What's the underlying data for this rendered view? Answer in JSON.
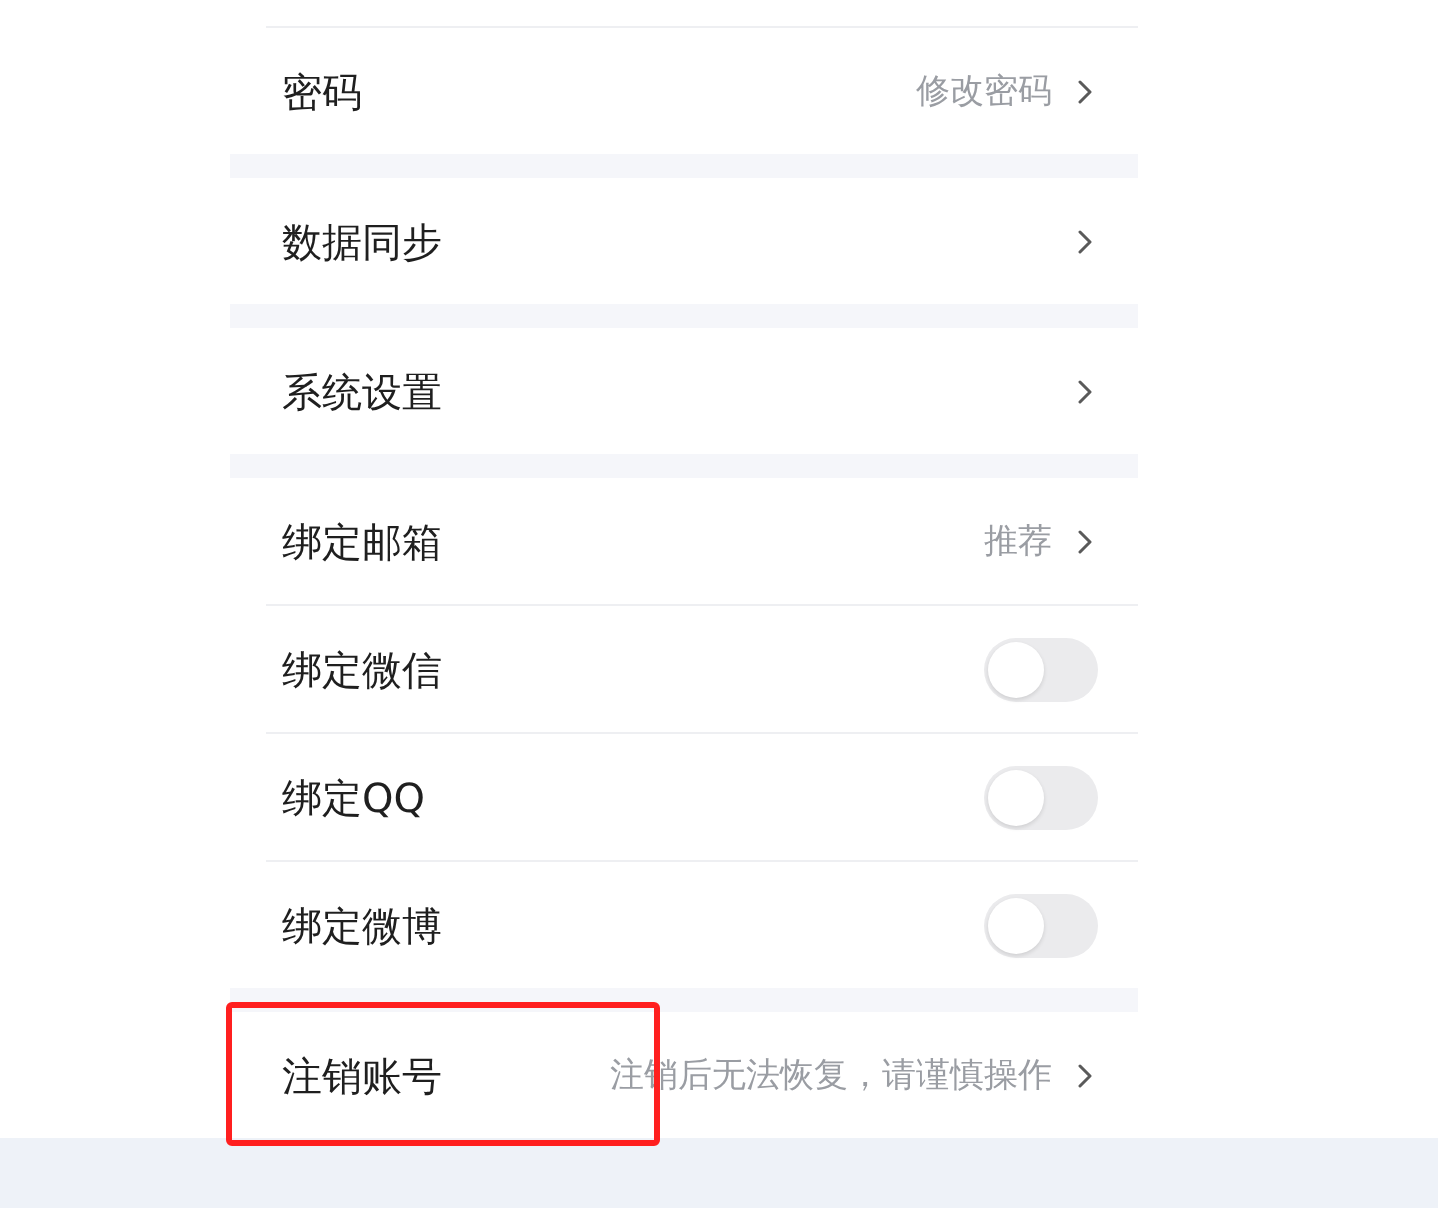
{
  "groups": [
    {
      "items": [
        {
          "kind": "link",
          "label": "密码",
          "hint": "修改密码",
          "highlighted": false
        }
      ]
    },
    {
      "items": [
        {
          "kind": "link",
          "label": "数据同步",
          "highlighted": false
        }
      ]
    },
    {
      "items": [
        {
          "kind": "link",
          "label": "系统设置",
          "highlighted": false
        }
      ]
    },
    {
      "items": [
        {
          "kind": "link",
          "label": "绑定邮箱",
          "hint": "推荐",
          "highlighted": false
        },
        {
          "kind": "switch",
          "label": "绑定微信",
          "on": false,
          "highlighted": false
        },
        {
          "kind": "switch",
          "label": "绑定QQ",
          "on": false,
          "highlighted": false
        },
        {
          "kind": "switch",
          "label": "绑定微博",
          "on": false,
          "highlighted": false
        }
      ]
    },
    {
      "items": [
        {
          "kind": "link",
          "label": "注销账号",
          "hint": "注销后无法恢复，请谨慎操作",
          "highlighted": true
        }
      ]
    }
  ]
}
